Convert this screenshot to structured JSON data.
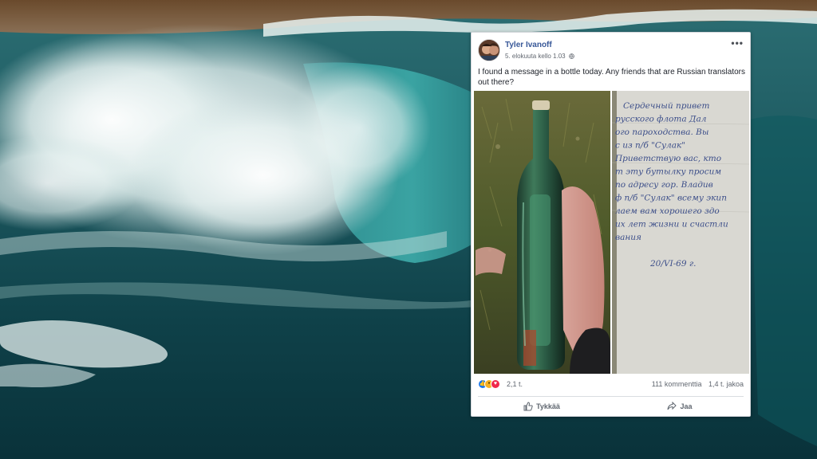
{
  "post": {
    "author": "Tyler Ivanoff",
    "timestamp": "5. elokuuta kello 1.03",
    "privacy_icon": "globe-icon",
    "more_label": "•••",
    "text": "I found a message in a bottle today. Any friends that are Russian translators out there?",
    "images": [
      {
        "name": "bottle-photo",
        "description": "green glass bottle held in hand"
      },
      {
        "name": "letter-photo",
        "description": "handwritten note"
      }
    ],
    "letter_lines": [
      "Сердечный привет",
      "русского флота Дал",
      "ого пароходства. Вы",
      "с из п/б \"Сулак\"",
      "Приветствую вас, кто",
      "т эту бутылку просим",
      "по адресу гор. Владив",
      "ф п/б \"Сулак\" всему экип",
      "лаем вам хорошего здо",
      "их лет жизни и счастли",
      "вания",
      "20/VI-69 г."
    ],
    "reactions": {
      "icons": [
        "like-icon",
        "wow-icon",
        "love-icon"
      ],
      "count": "2,1 t."
    },
    "stats": {
      "comments": "111 kommenttia",
      "shares": "1,4 t. jakoa"
    },
    "actions": {
      "like": "Tykkää",
      "share": "Jaa"
    }
  },
  "colors": {
    "author_link": "#385898",
    "like_blue": "#1877f2",
    "love_red": "#f0284a",
    "wow_yellow": "#f7b125"
  }
}
